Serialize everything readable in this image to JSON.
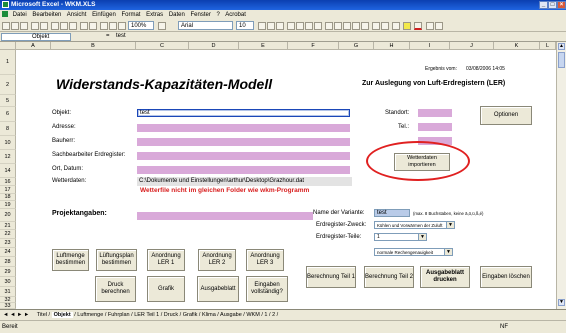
{
  "window": {
    "title": "Microsoft Excel - WKM.XLS",
    "controls": [
      "_",
      "□",
      "×"
    ]
  },
  "menu": [
    "Datei",
    "Bearbeiten",
    "Ansicht",
    "Einfügen",
    "Format",
    "Extras",
    "Daten",
    "Fenster",
    "?",
    "Acrobat"
  ],
  "toolbar": {
    "zoom": "100%",
    "font": "Arial",
    "font_size": "10"
  },
  "formula": {
    "name_box": "Objekt",
    "fx": "=",
    "value": "test"
  },
  "columns": [
    "A",
    "B",
    "C",
    "D",
    "E",
    "F",
    "G",
    "H",
    "I",
    "J",
    "K",
    "L"
  ],
  "rows": [
    "1",
    "2",
    "5",
    "6",
    "8",
    "10",
    "12",
    "14",
    "16",
    "17",
    "18",
    "19",
    "20",
    "21",
    "22",
    "23",
    "24",
    "28",
    "29",
    "30",
    "31",
    "32",
    "33"
  ],
  "sheet": {
    "ergebnis_label": "Ergebnis vom:",
    "ergebnis_date": "03/08/2006 14:05",
    "title": "Widerstands-Kapazitäten-Modell",
    "subtitle": "Zur Auslegung von Luft-Erdregistern (LER)",
    "fields": [
      {
        "label": "Objekt:",
        "value": "test"
      },
      {
        "label": "Adresse:",
        "value": ""
      },
      {
        "label": "Bauherr:",
        "value": ""
      },
      {
        "label": "Sachbearbeiter Erdregister:",
        "value": ""
      },
      {
        "label": "Ort, Datum:",
        "value": ""
      }
    ],
    "wetter_label": "Wetterdaten:",
    "wetter_path": "C:\\Dokumente und Einstellungen\\arthur\\Desktop\\Grazhour.dat",
    "wetter_warning": "Wetterfile nicht im gleichen Folder wie wkm-Programm",
    "standort_label": "Standort:",
    "tel_label": "Tel.:",
    "optionen": "Optionen",
    "wetter_import": "Wetterdaten importieren",
    "projekt_label": "Projektangaben:",
    "variante_label": "Name der Variante:",
    "variante_value": "test",
    "variante_hint": "(max. 8 Buchstaben, keine ä,ö,ü,ß,é)",
    "zweck_label": "Erdregister-Zweck:",
    "zweck_value": "Kühlen und Vorwärmen der Zuluft",
    "teile_label": "Erdregister-Teile:",
    "teile_value": "1",
    "genauigkeit_value": "normale Rechengenauigkeit"
  },
  "buttons_row1": [
    "Luftmenge bestimmen",
    "Lüftungsplan bestimmen",
    "Anordnung LER 1",
    "Anordnung LER 2",
    "Anordnung LER 3"
  ],
  "buttons_row2": [
    "Druck berechnen",
    "Grafik",
    "Ausgabeblatt",
    "Eingaben vollständig?"
  ],
  "buttons_right": [
    "Berechnung Teil 1",
    "Berechnung Teil 2",
    "Ausgabeblatt drucken",
    "Eingaben löschen"
  ],
  "sheet_tabs": [
    "Titel",
    "Objekt",
    "Luftmenge",
    "Fuhrplan",
    "LER Teil 1",
    "Druck",
    "Grafik",
    "Klima",
    "Ausgabe",
    "WKM",
    "1",
    "2"
  ],
  "active_tab": "Objekt",
  "status": {
    "left": "Bereit",
    "right": "NF"
  }
}
